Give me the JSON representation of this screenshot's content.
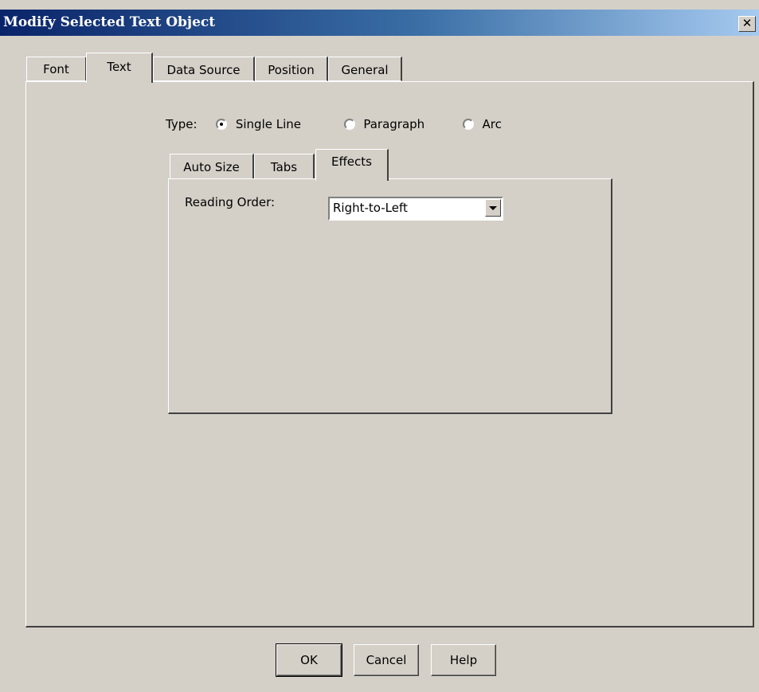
{
  "window": {
    "title": "Modify Selected Text Object",
    "close_glyph": "✕"
  },
  "main_tabs": [
    "Font",
    "Text",
    "Data Source",
    "Position",
    "General"
  ],
  "active_main_tab": "Text",
  "type_row": {
    "label": "Type:",
    "options": [
      {
        "label": "Single Line",
        "checked": true
      },
      {
        "label": "Paragraph",
        "checked": false
      },
      {
        "label": "Arc",
        "checked": false
      }
    ]
  },
  "sub_tabs": [
    "Auto Size",
    "Tabs",
    "Effects"
  ],
  "active_sub_tab": "Effects",
  "effects": {
    "reading_order_label": "Reading Order:",
    "reading_order_value": "Right-to-Left"
  },
  "buttons": {
    "ok": "OK",
    "cancel": "Cancel",
    "help": "Help"
  }
}
